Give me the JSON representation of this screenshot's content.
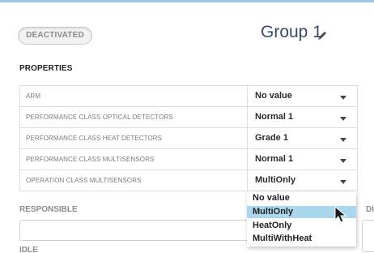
{
  "colors": {
    "accent_rule": "#9ec5e5",
    "title_blue": "#3a4a6a",
    "option_highlight": "#a9d8ee"
  },
  "header": {
    "status": "DEACTIVATED",
    "group_name": "Group 1",
    "edit_icon": "pencil-icon"
  },
  "properties": {
    "title": "PROPERTIES",
    "rows": [
      {
        "label": "ARM",
        "value": "No value"
      },
      {
        "label": "PERFORMANCE CLASS OPTICAL DETECTORS",
        "value": "Normal 1"
      },
      {
        "label": "PERFORMANCE CLASS HEAT DETECTORS",
        "value": "Grade 1"
      },
      {
        "label": "PERFORMANCE CLASS MULTISENSORS",
        "value": "Normal 1"
      },
      {
        "label": "OPERATION CLASS MULTISENSORS",
        "value": "MultiOnly"
      }
    ]
  },
  "dropdown": {
    "options": [
      "No value",
      "MultiOnly",
      "HeatOnly",
      "MultiWithHeat"
    ],
    "highlighted": "MultiOnly"
  },
  "responsible": {
    "label": "RESPONSIBLE",
    "value": ""
  },
  "idle": {
    "label": "IDLE"
  },
  "side_label": "DI"
}
